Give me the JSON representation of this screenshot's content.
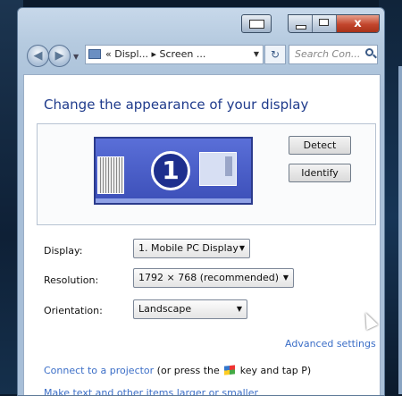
{
  "window": {
    "caption": {
      "close_glyph": "x"
    }
  },
  "nav": {
    "address_crumbs": "« Displ... ▸ Screen ...",
    "search_placeholder": "Search Con..."
  },
  "main": {
    "heading": "Change the appearance of your display",
    "monitor_number": "1",
    "detect_label": "Detect",
    "identify_label": "Identify",
    "display_label": "Display:",
    "display_value": "1. Mobile PC Display",
    "resolution_label": "Resolution:",
    "resolution_value": "1792 × 768 (recommended)",
    "orientation_label": "Orientation:",
    "orientation_value": "Landscape",
    "advanced_link": "Advanced settings",
    "projector_link": "Connect to a projector",
    "projector_text_pre": " (or press the ",
    "projector_text_post": " key and tap P)",
    "text_size_link": "Make text and other items larger or smaller"
  },
  "colors": {
    "heading": "#1f3b8c",
    "link": "#3b6ec7",
    "monitor": "#4a5fd0"
  }
}
